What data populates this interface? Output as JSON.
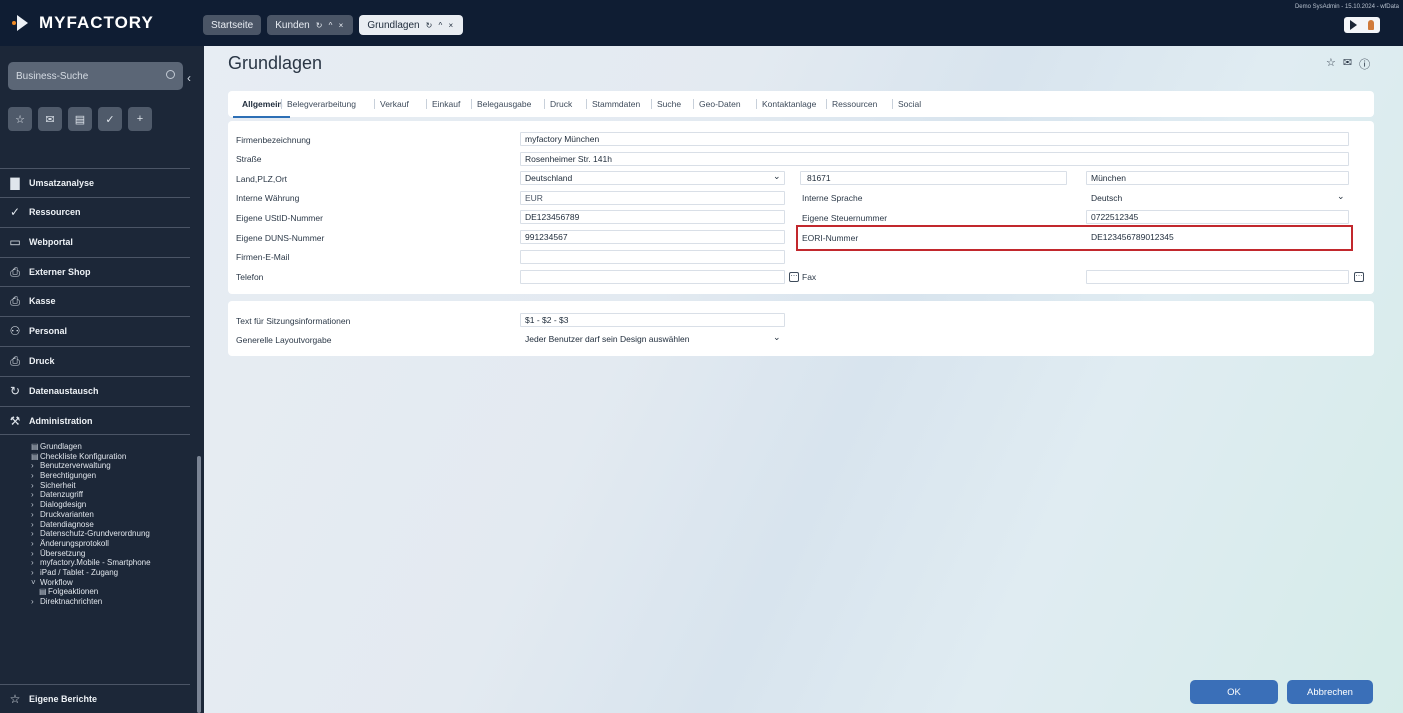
{
  "app": {
    "logo_text": "MYFACTORY",
    "user_info": "Demo SysAdmin - 15.10.2024 - wfData"
  },
  "top_tabs": [
    {
      "label": "Startseite",
      "controls": ""
    },
    {
      "label": "Kunden",
      "controls": "↻ ^ ×"
    },
    {
      "label": "Grundlagen",
      "controls": "↻ ^ ×"
    }
  ],
  "sidebar": {
    "search_placeholder": "Business-Suche",
    "collapse_icon": "‹",
    "quick_icons": [
      "☆",
      "✉",
      "▤",
      "✓",
      "+"
    ],
    "nav": [
      {
        "label": "Umsatzanalyse",
        "icon": "▇"
      },
      {
        "label": "Ressourcen",
        "icon": "✓"
      },
      {
        "label": "Webportal",
        "icon": "▭"
      },
      {
        "label": "Externer Shop",
        "icon": "⎙"
      },
      {
        "label": "Kasse",
        "icon": "⎙"
      },
      {
        "label": "Personal",
        "icon": "⚇"
      },
      {
        "label": "Druck",
        "icon": "⎙"
      },
      {
        "label": "Datenaustausch",
        "icon": "↻"
      },
      {
        "label": "Administration",
        "icon": "⚒"
      }
    ],
    "subnav": [
      {
        "label": "Grundlagen",
        "prefix": "▤",
        "deep": false
      },
      {
        "label": "Checkliste Konfiguration",
        "prefix": "▤",
        "deep": false
      },
      {
        "label": "Benutzerverwaltung",
        "prefix": "›",
        "deep": false
      },
      {
        "label": "Berechtigungen",
        "prefix": "›",
        "deep": false
      },
      {
        "label": "Sicherheit",
        "prefix": "›",
        "deep": false
      },
      {
        "label": "Datenzugriff",
        "prefix": "›",
        "deep": false
      },
      {
        "label": "Dialogdesign",
        "prefix": "›",
        "deep": false
      },
      {
        "label": "Druckvarianten",
        "prefix": "›",
        "deep": false
      },
      {
        "label": "Datendiagnose",
        "prefix": "›",
        "deep": false
      },
      {
        "label": "Datenschutz-Grundverordnung",
        "prefix": "›",
        "deep": false
      },
      {
        "label": "Änderungsprotokoll",
        "prefix": "›",
        "deep": false
      },
      {
        "label": "Übersetzung",
        "prefix": "›",
        "deep": false
      },
      {
        "label": "myfactory.Mobile - Smartphone",
        "prefix": "›",
        "deep": false
      },
      {
        "label": "iPad / Tablet - Zugang",
        "prefix": "›",
        "deep": false
      },
      {
        "label": "Workflow",
        "prefix": "˅",
        "deep": false
      },
      {
        "label": "Folgeaktionen",
        "prefix": "▤",
        "deep": true
      },
      {
        "label": "Direktnachrichten",
        "prefix": "›",
        "deep": false
      }
    ],
    "bottom": {
      "label": "Eigene Berichte",
      "icon": "☆"
    }
  },
  "main": {
    "title": "Grundlagen",
    "title_icons": [
      "☆",
      "✉",
      "ⓘ"
    ],
    "tabs": [
      "Allgemein",
      "Belegverarbeitung",
      "Verkauf",
      "Einkauf",
      "Belegausgabe",
      "Druck",
      "Stammdaten",
      "Suche",
      "Geo-Daten",
      "Kontaktanlage",
      "Ressourcen",
      "Social"
    ]
  },
  "form": {
    "firmenbezeichnung": {
      "label": "Firmenbezeichnung",
      "value": "myfactory München"
    },
    "strasse": {
      "label": "Straße",
      "value": "Rosenheimer Str. 141h"
    },
    "land": {
      "label": "Land,PLZ,Ort",
      "country": "Deutschland",
      "plz": "81671",
      "ort": "München"
    },
    "waehrung": {
      "label": "Interne Währung",
      "value": "EUR"
    },
    "sprache": {
      "label": "Interne Sprache",
      "value": "Deutsch"
    },
    "ustid": {
      "label": "Eigene UStID-Nummer",
      "value": "DE123456789"
    },
    "steuernummer": {
      "label": "Eigene Steuernummer",
      "value": "0722512345"
    },
    "duns": {
      "label": "Eigene DUNS-Nummer",
      "value": "991234567"
    },
    "eori": {
      "label": "EORI-Nummer",
      "value": "DE123456789012345"
    },
    "email": {
      "label": "Firmen-E-Mail",
      "value": ""
    },
    "telefon": {
      "label": "Telefon",
      "value": ""
    },
    "fax": {
      "label": "Fax",
      "value": ""
    },
    "sitzung": {
      "label": "Text für Sitzungsinformationen",
      "value": "$1 - $2 - $3"
    },
    "layout": {
      "label": "Generelle Layoutvorgabe",
      "value": "Jeder Benutzer darf sein Design auswählen"
    },
    "dropdown_icon": "⌄",
    "phone_icon": "⋯"
  },
  "buttons": {
    "ok": "OK",
    "cancel": "Abbrechen"
  },
  "colors": {
    "topbar": "#0f1d33",
    "sidebar": "#1c2738",
    "accent": "#3a6fb8",
    "highlight": "#c2282d"
  }
}
